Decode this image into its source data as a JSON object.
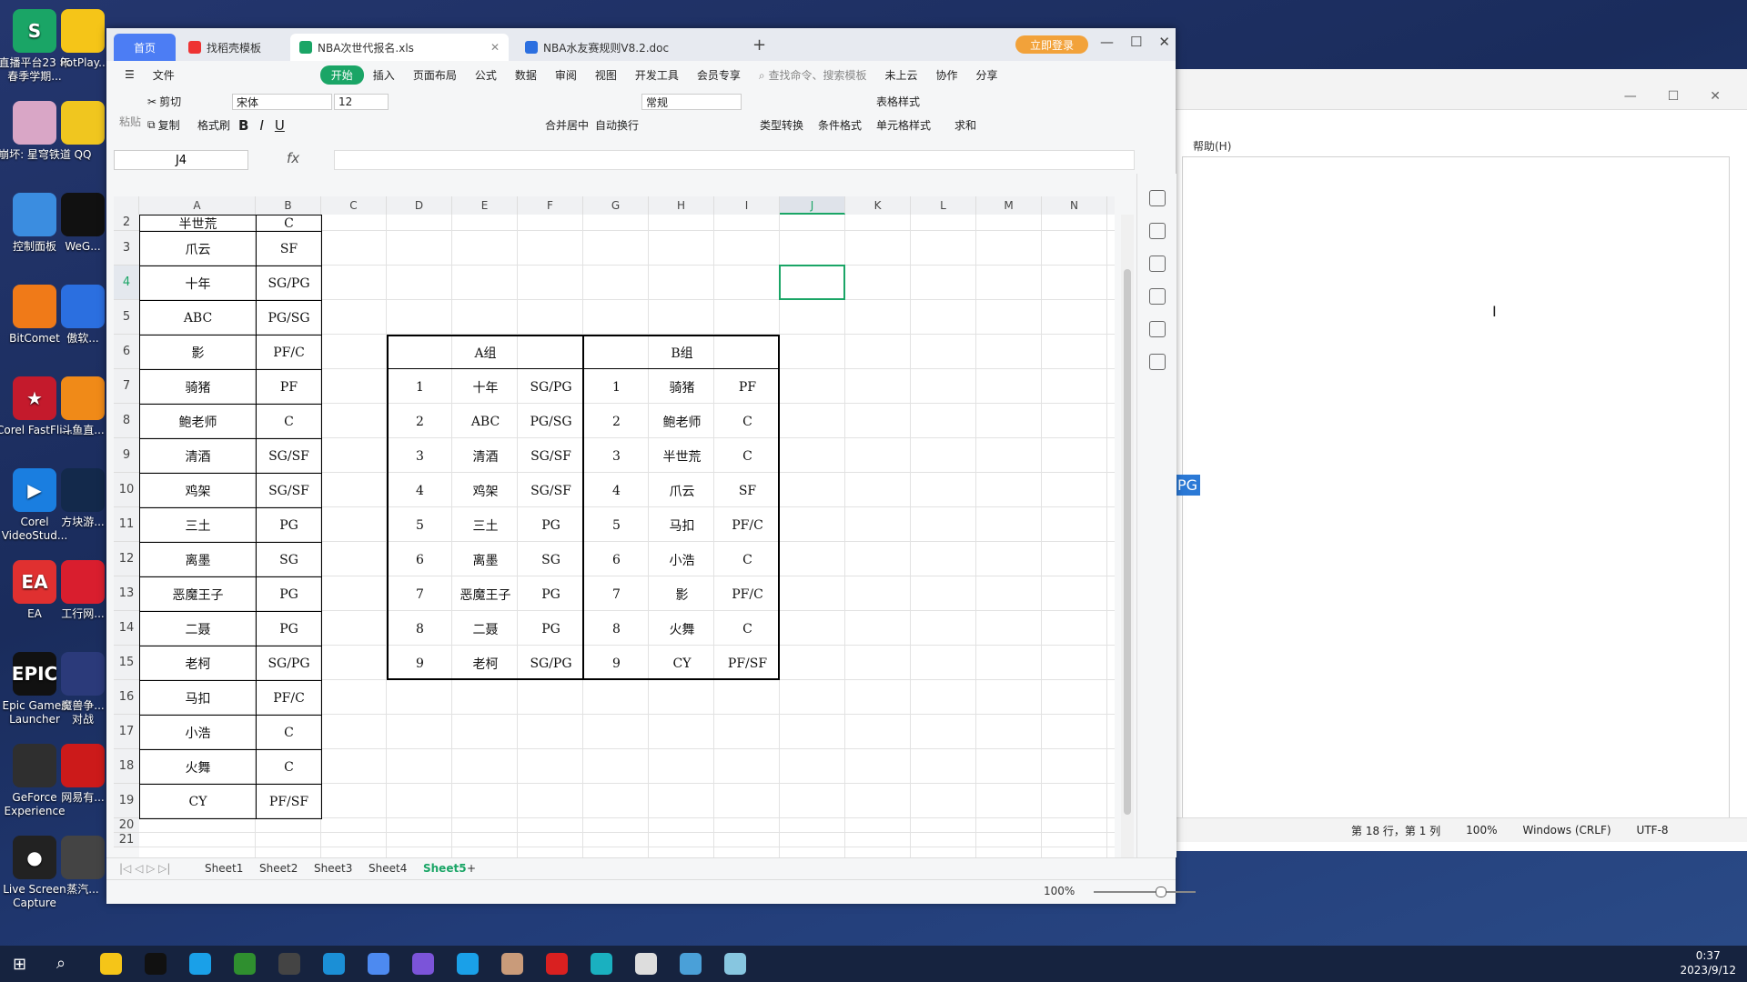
{
  "desktop": {
    "icons": [
      {
        "label": "直播平台23 年春季学期...",
        "color": "#1aa566",
        "glyph": "S"
      },
      {
        "label": "崩坏: 星穹铁道",
        "color": "#d9a6c6",
        "glyph": ""
      },
      {
        "label": "控制面板",
        "color": "#3b8de0",
        "glyph": ""
      },
      {
        "label": "BitComet",
        "color": "#f07a18",
        "glyph": ""
      },
      {
        "label": "Corel FastFli...",
        "color": "#c41a2c",
        "glyph": "★"
      },
      {
        "label": "Corel VideoStud...",
        "color": "#1a7ee0",
        "glyph": "▶"
      },
      {
        "label": "EA",
        "color": "#e03030",
        "glyph": "EA"
      },
      {
        "label": "Epic Games Launcher",
        "color": "#111111",
        "glyph": "EPIC"
      },
      {
        "label": "GeForce Experience",
        "color": "#2f2f2f",
        "glyph": ""
      },
      {
        "label": "Live Screen Capture",
        "color": "#222222",
        "glyph": "●"
      }
    ],
    "icons_col2": [
      "PotPlay...",
      "QQ",
      "WeG...",
      "傲软...",
      "斗鱼直...",
      "方块游...",
      "工行网...",
      "魔兽争... 对战",
      "网易有...",
      "蒸汽..."
    ]
  },
  "wps": {
    "tabs": {
      "home": "首页",
      "t1": "找稻壳模板",
      "t2": "NBA次世代报名.xls",
      "t3": "NBA水友赛规则V8.2.doc"
    },
    "login": "立即登录",
    "menu": [
      "文件",
      "开始",
      "插入",
      "页面布局",
      "公式",
      "数据",
      "审阅",
      "视图",
      "开发工具",
      "会员专享"
    ],
    "search_placeholder": "查找命令、搜索模板",
    "menu_right": [
      "未上云",
      "协作",
      "分享"
    ],
    "ribbon": {
      "paste": "粘贴",
      "cut": "剪切",
      "copy": "复制",
      "format_painter": "格式刷",
      "font": "宋体",
      "size": "12",
      "merge": "合并居中",
      "wrap": "自动换行",
      "number_format": "常规",
      "type_convert": "类型转换",
      "cond_format": "条件格式",
      "table_style": "表格样式",
      "cell_style": "单元格样式",
      "sum": "求和"
    },
    "namebox": "J4",
    "fx": "fx",
    "columns": [
      "A",
      "B",
      "C",
      "D",
      "E",
      "F",
      "G",
      "H",
      "I",
      "J",
      "K",
      "L",
      "M",
      "N"
    ],
    "rows": [
      "2",
      "3",
      "4",
      "5",
      "6",
      "7",
      "8",
      "9",
      "10",
      "11",
      "12",
      "13",
      "14",
      "15",
      "16",
      "17",
      "18",
      "19",
      "20",
      "21"
    ],
    "players": [
      [
        "半世荒",
        "C"
      ],
      [
        "爪云",
        "SF"
      ],
      [
        "十年",
        "SG/PG"
      ],
      [
        "ABC",
        "PG/SG"
      ],
      [
        "影",
        "PF/C"
      ],
      [
        "骑猪",
        "PF"
      ],
      [
        "鲍老师",
        "C"
      ],
      [
        "清酒",
        "SG/SF"
      ],
      [
        "鸡架",
        "SG/SF"
      ],
      [
        "三土",
        "PG"
      ],
      [
        "离墨",
        "SG"
      ],
      [
        "恶魔王子",
        "PG"
      ],
      [
        "二聂",
        "PG"
      ],
      [
        "老柯",
        "SG/PG"
      ],
      [
        "马扣",
        "PF/C"
      ],
      [
        "小浩",
        "C"
      ],
      [
        "火舞",
        "C"
      ],
      [
        "CY",
        "PF/SF"
      ]
    ],
    "groups": {
      "a_title": "A组",
      "b_title": "B组",
      "rows": [
        [
          "1",
          "十年",
          "SG/PG",
          "1",
          "骑猪",
          "PF"
        ],
        [
          "2",
          "ABC",
          "PG/SG",
          "2",
          "鲍老师",
          "C"
        ],
        [
          "3",
          "清酒",
          "SG/SF",
          "3",
          "半世荒",
          "C"
        ],
        [
          "4",
          "鸡架",
          "SG/SF",
          "4",
          "爪云",
          "SF"
        ],
        [
          "5",
          "三土",
          "PG",
          "5",
          "马扣",
          "PF/C"
        ],
        [
          "6",
          "离墨",
          "SG",
          "6",
          "小浩",
          "C"
        ],
        [
          "7",
          "恶魔王子",
          "PG",
          "7",
          "影",
          "PF/C"
        ],
        [
          "8",
          "二聂",
          "PG",
          "8",
          "火舞",
          "C"
        ],
        [
          "9",
          "老柯",
          "SG/PG",
          "9",
          "CY",
          "PF/SF"
        ]
      ]
    },
    "sheets": [
      "Sheet1",
      "Sheet2",
      "Sheet3",
      "Sheet4",
      "Sheet5"
    ],
    "active_sheet": "Sheet5",
    "zoom": "100%"
  },
  "bgwindow": {
    "menu_help": "帮助(H)",
    "status": [
      "第 18 行，第 1 列",
      "100%",
      "Windows (CRLF)",
      "UTF-8"
    ],
    "fragment": "PG"
  },
  "taskbar": {
    "time": "0:37",
    "date": "2023/9/12"
  }
}
